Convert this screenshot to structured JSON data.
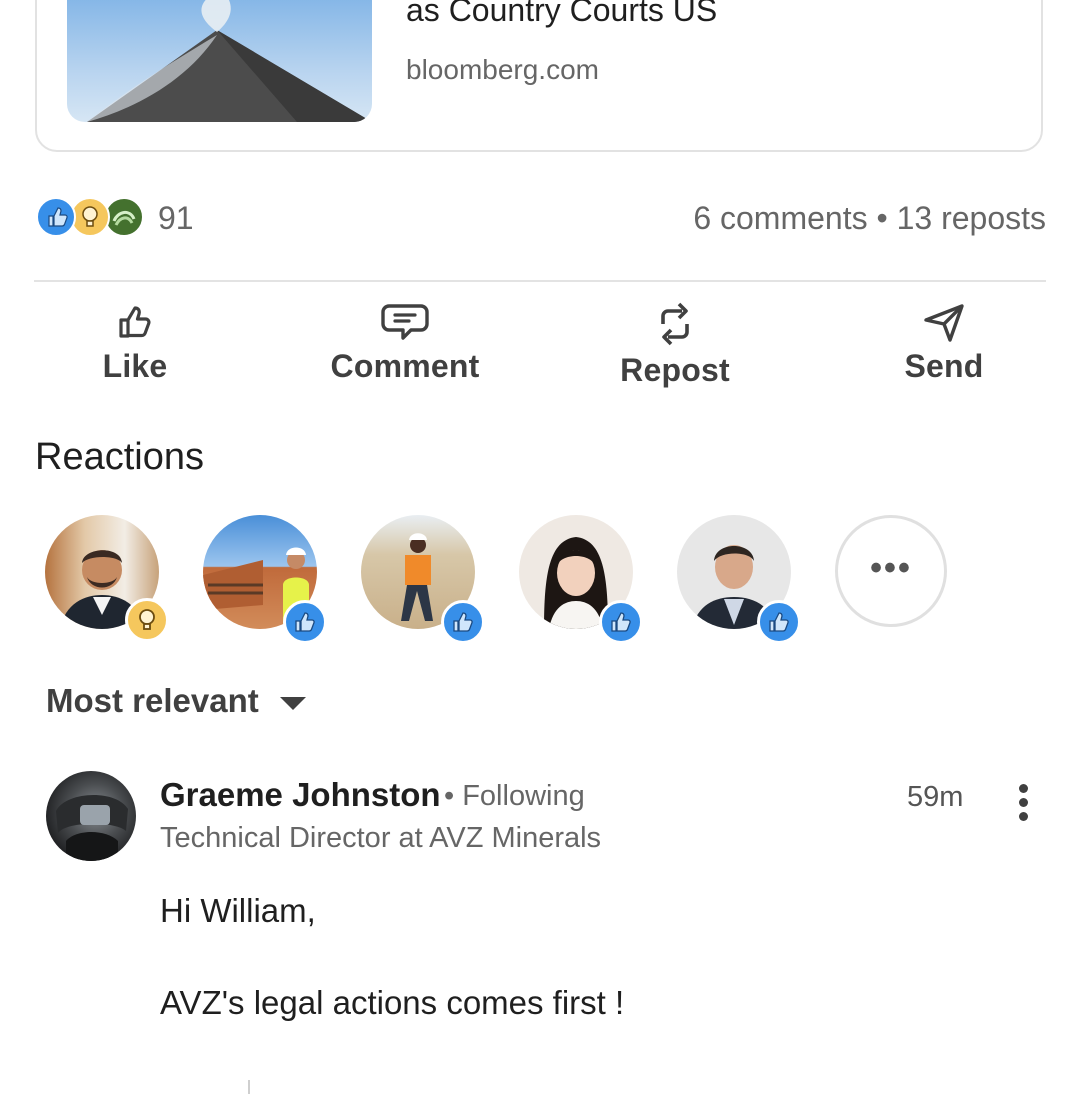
{
  "link_card": {
    "title": "as Country Courts US",
    "domain": "bloomberg.com"
  },
  "social": {
    "reaction_count": "91",
    "comments_reposts": "6 comments • 13 reposts",
    "reaction_types": [
      "like-icon",
      "insightful-icon",
      "support-icon"
    ]
  },
  "actions": [
    {
      "label": "Like",
      "icon": "thumbs-up-icon"
    },
    {
      "label": "Comment",
      "icon": "comment-icon"
    },
    {
      "label": "Repost",
      "icon": "repost-icon"
    },
    {
      "label": "Send",
      "icon": "send-icon"
    }
  ],
  "reactions": {
    "title": "Reactions",
    "more_label": "•••"
  },
  "sort": {
    "label": "Most relevant"
  },
  "comment": {
    "author": "Graeme Johnston",
    "relationship": "• Following",
    "headline": "Technical Director at AVZ Minerals",
    "time": "59m",
    "body": "Hi William,\n\nAVZ's legal actions comes first !"
  },
  "colors": {
    "like_blue": "#378fe9",
    "insight_gold": "#f5c75d",
    "support_green": "#44712e",
    "text_primary": "#1f1f1f",
    "text_secondary": "#666666"
  }
}
